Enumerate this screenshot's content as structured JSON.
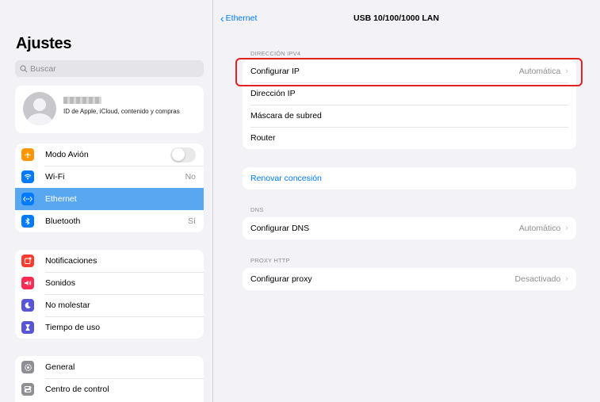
{
  "sidebar": {
    "title": "Ajustes",
    "search_placeholder": "Buscar",
    "profile": {
      "subtitle": "ID de Apple, iCloud, contenido y compras"
    },
    "group1": [
      {
        "label": "Modo Avión",
        "icon": "airplane-icon",
        "color": "#ff9500"
      },
      {
        "label": "Wi-Fi",
        "value": "No",
        "icon": "wifi-icon",
        "color": "#007aff"
      },
      {
        "label": "Ethernet",
        "icon": "ethernet-icon",
        "color": "#007aff",
        "selected": true
      },
      {
        "label": "Bluetooth",
        "value": "Sí",
        "icon": "bluetooth-icon",
        "color": "#007aff"
      }
    ],
    "group2": [
      {
        "label": "Notificaciones",
        "icon": "notifications-icon",
        "color": "#ff3b30"
      },
      {
        "label": "Sonidos",
        "icon": "sounds-icon",
        "color": "#ff2d55"
      },
      {
        "label": "No molestar",
        "icon": "moon-icon",
        "color": "#5856d6"
      },
      {
        "label": "Tiempo de uso",
        "icon": "hourglass-icon",
        "color": "#5856d6"
      }
    ],
    "group3": [
      {
        "label": "General",
        "icon": "gear-icon",
        "color": "#8e8e93"
      },
      {
        "label": "Centro de control",
        "icon": "control-center-icon",
        "color": "#8e8e93"
      }
    ]
  },
  "detail": {
    "back_label": "Ethernet",
    "title": "USB 10/100/1000 LAN",
    "ipv4_header": "DIRECCIÓN IPV4",
    "ipv4_rows": [
      {
        "label": "Configurar IP",
        "value": "Automática",
        "chevron": true
      },
      {
        "label": "Dirección IP"
      },
      {
        "label": "Máscara de subred"
      },
      {
        "label": "Router"
      }
    ],
    "renew_label": "Renovar concesión",
    "dns_header": "DNS",
    "dns_row": {
      "label": "Configurar DNS",
      "value": "Automático"
    },
    "proxy_header": "PROXY HTTP",
    "proxy_row": {
      "label": "Configurar proxy",
      "value": "Desactivado"
    }
  },
  "colors": {
    "accent": "#007aff",
    "selected_row": "#5aa7f1",
    "highlight": "#e32222"
  }
}
